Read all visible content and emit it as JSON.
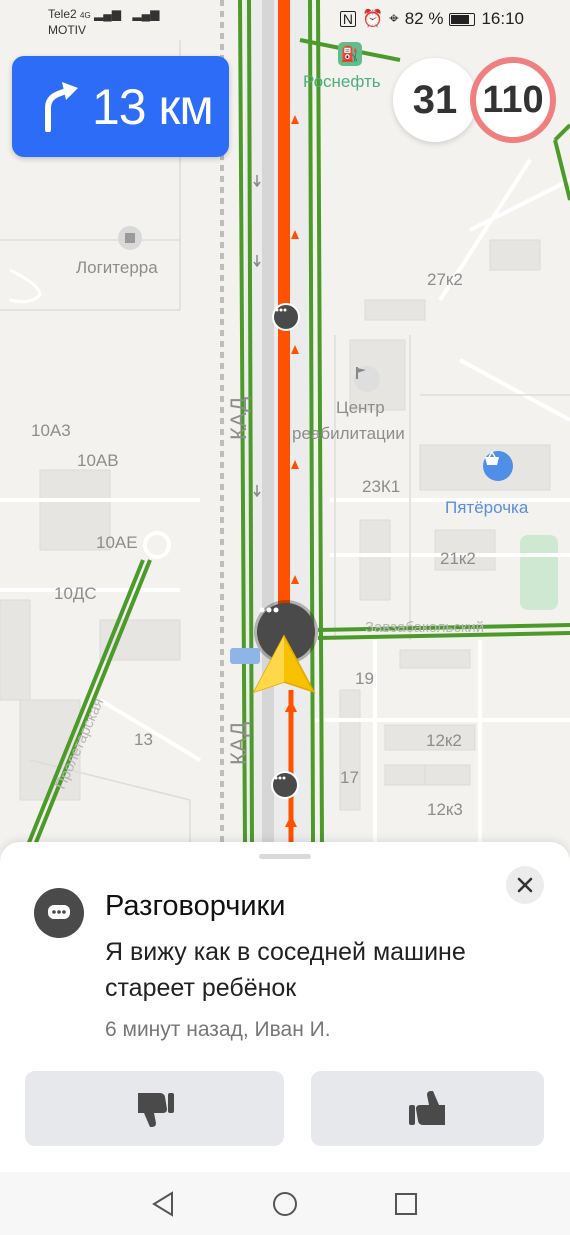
{
  "status_bar": {
    "carrier1": "Tele2",
    "carrier2": "MOTIV",
    "net1": "4G",
    "battery": "82 %",
    "time": "16:10"
  },
  "navigation": {
    "distance": "13 км",
    "turn_icon": "turn-right-icon",
    "current_speed": "31",
    "speed_limit": "110"
  },
  "map_labels": {
    "rosneft": "Роснефть",
    "logiterra": "Логитерра",
    "kad_top": "КАД",
    "kad_bottom": "КАД",
    "center_line1": "Центр",
    "center_line2": "реабилитации",
    "pyaterochka": "Пятёрочка",
    "street_right": "Завзабакольский",
    "street_left": "Пролетарская",
    "b27k2": "27к2",
    "b10a3": "10А3",
    "b10av": "10АВ",
    "b10ae": "10АЕ",
    "b10ds": "10ДС",
    "b23k1": "23К1",
    "b21k2": "21к2",
    "b19": "19",
    "b13": "13",
    "b17": "17",
    "b12k2": "12к2",
    "b12k3": "12к3"
  },
  "event_card": {
    "title": "Разговорчики",
    "text": "Я вижу как в соседней машине стареет  ребёнок",
    "meta": "6 минут назад, Иван И.",
    "icon": "chat-icon"
  },
  "colors": {
    "accent": "#2d6cf7",
    "route": "#ff5100",
    "green_road": "#4c9a2a",
    "cursor": "#f7c100"
  }
}
